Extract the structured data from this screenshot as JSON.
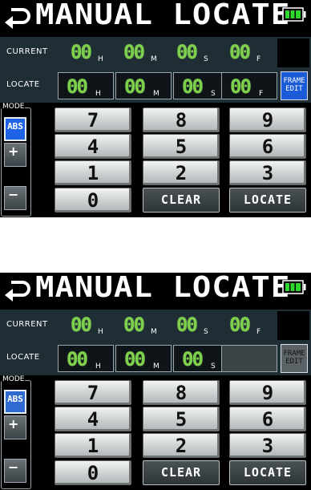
{
  "title": "MANUAL LOCATE",
  "screens": [
    {
      "current": {
        "label": "CURRENT",
        "fields": [
          {
            "value": "00",
            "unit": "H"
          },
          {
            "value": "00",
            "unit": "M"
          },
          {
            "value": "00",
            "unit": "S"
          },
          {
            "value": "00",
            "unit": "F"
          }
        ]
      },
      "locate": {
        "label": "LOCATE",
        "fields": [
          {
            "value": "00",
            "unit": "H"
          },
          {
            "value": "00",
            "unit": "M"
          },
          {
            "value": "00",
            "unit": "S"
          },
          {
            "value": "00",
            "unit": "F"
          }
        ],
        "frame_edit": "FRAME EDIT",
        "frame_edit_active": true
      },
      "mode": {
        "label": "MODE",
        "abs": "ABS",
        "plus": "+",
        "minus": "−"
      },
      "keys": [
        "7",
        "8",
        "9",
        "4",
        "5",
        "6",
        "1",
        "2",
        "3",
        "0",
        "CLEAR",
        "LOCATE"
      ]
    },
    {
      "current": {
        "label": "CURRENT",
        "fields": [
          {
            "value": "00",
            "unit": "H"
          },
          {
            "value": "00",
            "unit": "M"
          },
          {
            "value": "00",
            "unit": "S"
          },
          {
            "value": "00",
            "unit": "F"
          }
        ]
      },
      "locate": {
        "label": "LOCATE",
        "fields": [
          {
            "value": "00",
            "unit": "H"
          },
          {
            "value": "00",
            "unit": "M"
          },
          {
            "value": "00",
            "unit": "S"
          },
          {
            "value": "",
            "unit": ""
          }
        ],
        "frame_edit": "FRAME EDIT",
        "frame_edit_active": false
      },
      "mode": {
        "label": "MODE",
        "abs": "ABS",
        "plus": "+",
        "minus": "−"
      },
      "keys": [
        "7",
        "8",
        "9",
        "4",
        "5",
        "6",
        "1",
        "2",
        "3",
        "0",
        "CLEAR",
        "LOCATE"
      ]
    }
  ],
  "colors": {
    "digit": "#7dd04c",
    "strip": "#1f2d34",
    "accent": "#1e63e6"
  },
  "icons": {
    "back": "back-arrow-icon",
    "battery": "battery-icon"
  }
}
